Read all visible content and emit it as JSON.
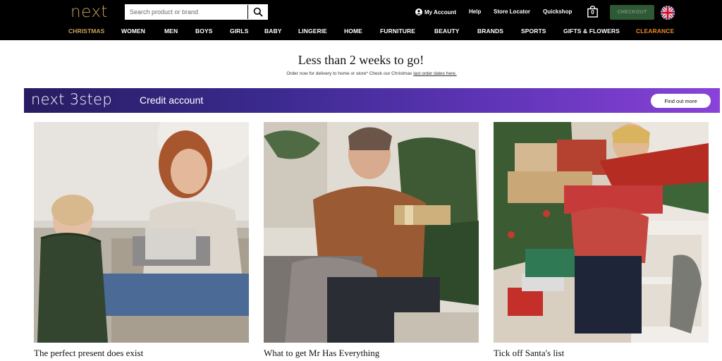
{
  "header": {
    "logo": "next",
    "search": {
      "placeholder": "Search product or brand",
      "icon": "search-icon"
    },
    "utility": {
      "my_account": "My Account",
      "help": "Help",
      "store_locator": "Store Locator",
      "quickshop": "Quickshop",
      "bag_count": "0",
      "checkout": "CHECKOUT",
      "country_icon": "uk-flag-icon"
    },
    "nav": [
      "CHRISTMAS",
      "WOMEN",
      "MEN",
      "BOYS",
      "GIRLS",
      "BABY",
      "LINGERIE",
      "HOME",
      "FURNITURE",
      "BEAUTY",
      "BRANDS",
      "SPORTS",
      "GIFTS & FLOWERS",
      "CLEARANCE"
    ]
  },
  "promo": {
    "headline": "Less than 2 weeks to go!",
    "subline_prefix": "Order now for delivery to home or store* Check our Christmas ",
    "subline_link": "last order dates here."
  },
  "banner": {
    "logo": "next 3step",
    "text": "Credit account",
    "button": "Find out more"
  },
  "cards": [
    {
      "caption": "The perfect present does exist"
    },
    {
      "caption": "What to get Mr Has Everything"
    },
    {
      "caption": "Tick off Santa's list"
    }
  ],
  "colors": {
    "header_bg": "#000000",
    "brand_gold": "#c9a25a",
    "clearance_orange": "#f08a24",
    "checkout_green": "#2d5a34",
    "banner_start": "#281c62",
    "banner_end": "#8a42d8"
  }
}
